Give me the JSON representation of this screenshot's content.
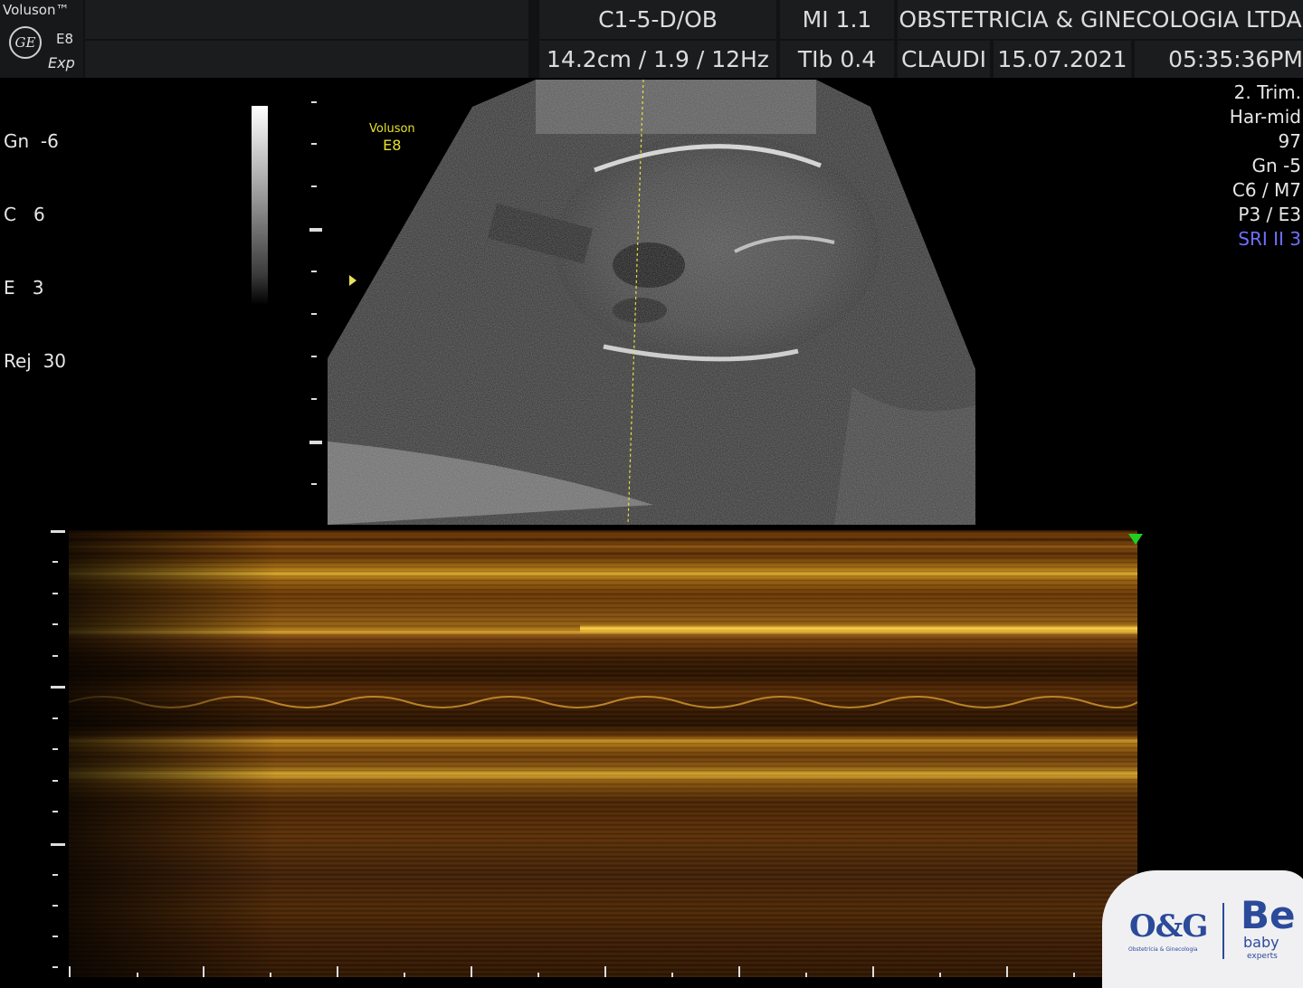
{
  "header": {
    "brand": "Voluson™",
    "logo_mark": "GE",
    "model": "E8",
    "variant": "Exp",
    "probe": "C1-5-D/OB",
    "mi": "MI  1.1",
    "institution": "OBSTETRICIA & GINECOLOGIA LTDA",
    "depth_freq": "14.2cm / 1.9 / 12Hz",
    "tib": "TIb  0.4",
    "operator": "CLAUDI",
    "date": "15.07.2021",
    "time": "05:35:36PM"
  },
  "left_params": [
    "Gn  -6",
    "C   6",
    "E   3",
    "Rej  30"
  ],
  "right_params": [
    "2. Trim.",
    "Har-mid",
    "97",
    "Gn  -5",
    "C6 / M7",
    "P3 / E3"
  ],
  "right_highlight": "SRI II 3",
  "watermark": {
    "line1": "Voluson",
    "line2": "E8"
  },
  "logo": {
    "og": "O&G",
    "og_sub": "Obstetrícia & Ginecologia",
    "be": "Be",
    "baby": "baby",
    "experts": "experts"
  },
  "colors": {
    "header_bg": "#1a1c1e",
    "highlight": "#6f6fff",
    "watermark": "#e8e030",
    "marker": "#20d020",
    "logo_blue": "#2b4a9a"
  }
}
